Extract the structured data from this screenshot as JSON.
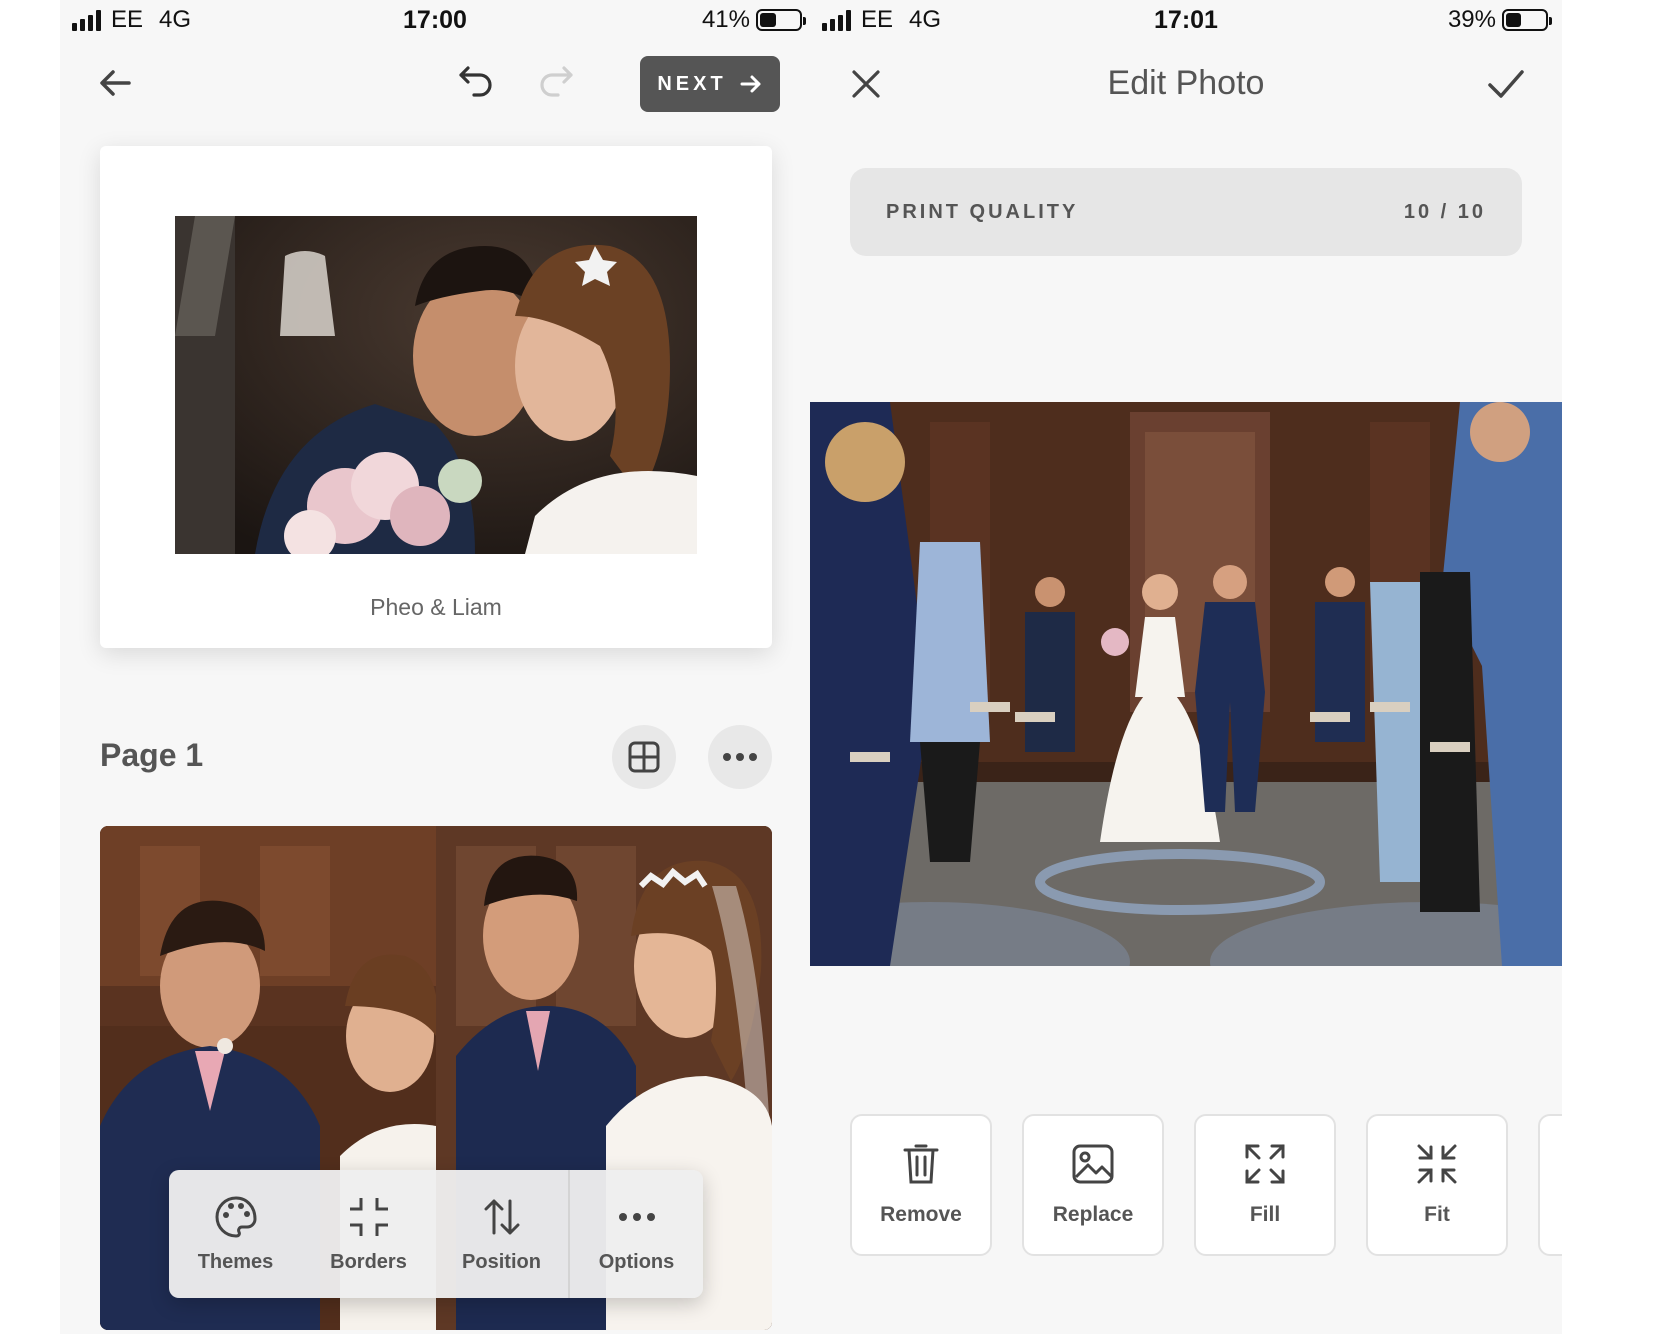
{
  "left": {
    "status": {
      "carrier": "EE",
      "network": "4G",
      "time": "17:00",
      "battery": "41%",
      "battery_level": 0.41
    },
    "header": {
      "next_label": "NEXT"
    },
    "cover": {
      "caption": "Pheo & Liam"
    },
    "page": {
      "title": "Page 1"
    },
    "toolbar": [
      {
        "label": "Themes",
        "icon": "palette-icon"
      },
      {
        "label": "Borders",
        "icon": "borders-icon"
      },
      {
        "label": "Position",
        "icon": "swap-vertical-icon"
      },
      {
        "label": "Options",
        "icon": "more-horizontal-icon"
      }
    ]
  },
  "right": {
    "status": {
      "carrier": "EE",
      "network": "4G",
      "time": "17:01",
      "battery": "39%",
      "battery_level": 0.39
    },
    "header": {
      "title": "Edit Photo"
    },
    "print_quality": {
      "label": "PRINT QUALITY",
      "value": "10 / 10"
    },
    "actions": [
      {
        "label": "Remove",
        "icon": "trash-icon"
      },
      {
        "label": "Replace",
        "icon": "image-icon"
      },
      {
        "label": "Fill",
        "icon": "expand-icon"
      },
      {
        "label": "Fit",
        "icon": "compress-icon"
      }
    ]
  }
}
